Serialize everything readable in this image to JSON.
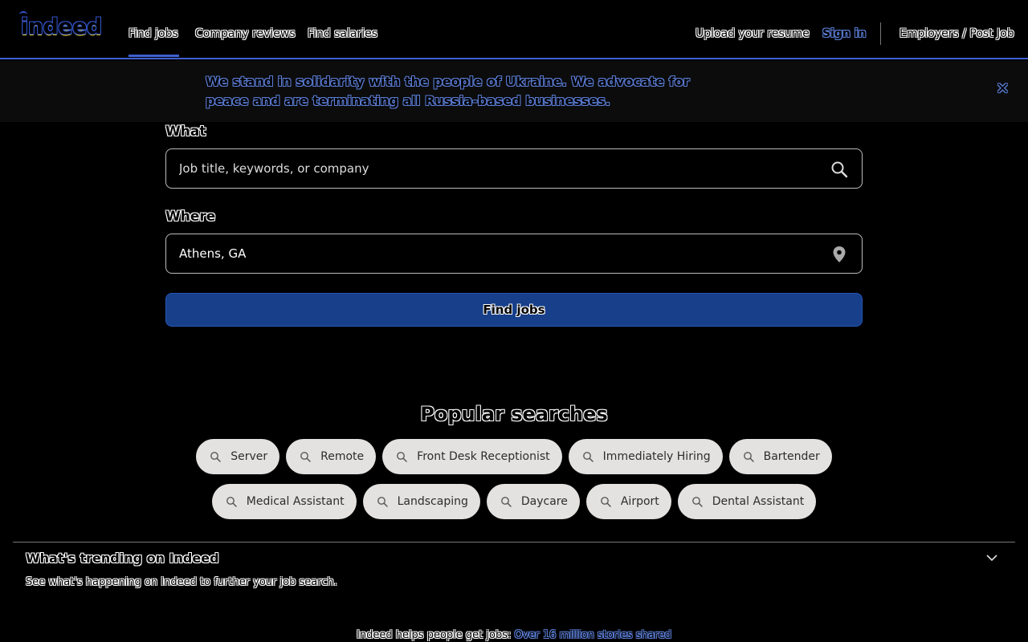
{
  "header": {
    "logo_text": "indeed",
    "nav": {
      "find_jobs": "Find jobs",
      "company_reviews": "Company reviews",
      "find_salaries": "Find salaries"
    },
    "upload_resume": "Upload your resume",
    "sign_in": "Sign in",
    "employers": "Employers / Post Job"
  },
  "banner": {
    "text": "We stand in solidarity with the people of Ukraine. We advocate for peace and are terminating all Russia-based businesses.",
    "close_label": "✕"
  },
  "search": {
    "what_label": "What",
    "what_placeholder": "Job title, keywords, or company",
    "where_label": "Where",
    "where_value": "Athens, GA",
    "find_button": "Find jobs"
  },
  "popular": {
    "title": "Popular searches",
    "row1": [
      "Server",
      "Remote",
      "Front Desk Receptionist",
      "Immediately Hiring",
      "Bartender"
    ],
    "row2": [
      "Medical Assistant",
      "Landscaping",
      "Daycare",
      "Airport",
      "Dental Assistant"
    ]
  },
  "trending": {
    "title": "What's trending on Indeed",
    "subtitle": "See what's happening on Indeed to further your job search."
  },
  "footer": {
    "text": "Indeed helps people get jobs:",
    "link": "Over 16 million stories shared"
  },
  "colors": {
    "accent": "#3f5fd0",
    "button": "#173f8a",
    "chip": "#e4e2e0"
  }
}
